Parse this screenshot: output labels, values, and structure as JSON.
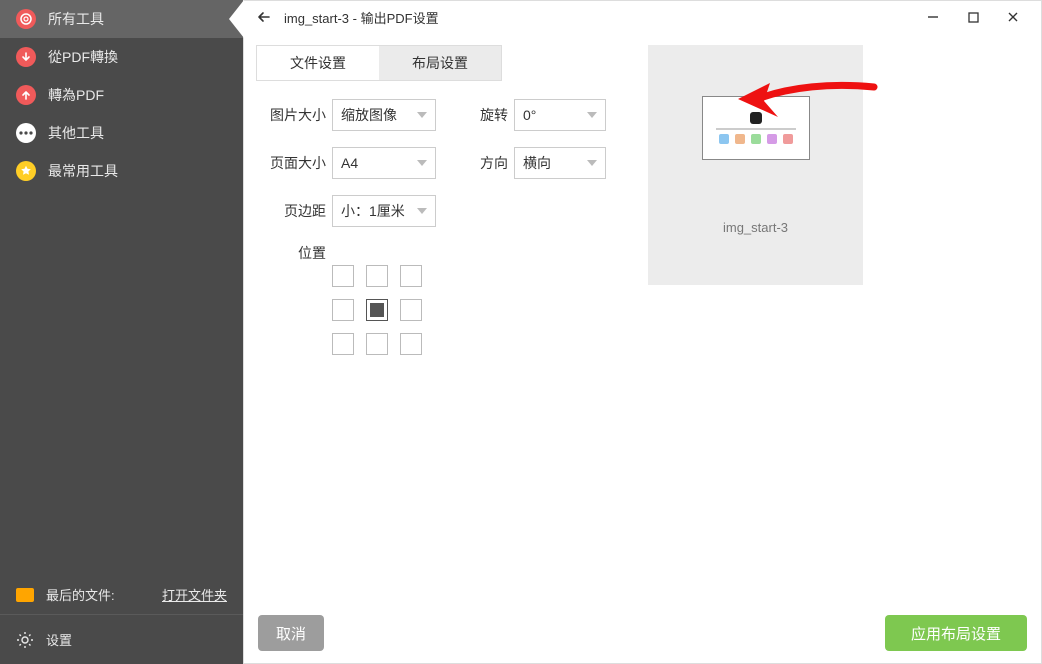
{
  "sidebar": {
    "items": [
      {
        "label": "所有工具",
        "icon": "spiral",
        "active": true
      },
      {
        "label": "從PDF轉換",
        "icon": "down"
      },
      {
        "label": "轉為PDF",
        "icon": "up"
      },
      {
        "label": "其他工具",
        "icon": "dots"
      },
      {
        "label": "最常用工具",
        "icon": "star"
      }
    ],
    "lastfile_label": "最后的文件:",
    "openfolder_label": "打开文件夹",
    "settings_label": "设置"
  },
  "titlebar": {
    "title": "img_start-3 - 输出PDF设置"
  },
  "tabs": {
    "file": "文件设置",
    "layout": "布局设置"
  },
  "form": {
    "image_size_label": "图片大小",
    "image_size_value": "缩放图像",
    "rotate_label": "旋转",
    "rotate_value": "0°",
    "page_size_label": "页面大小",
    "page_size_value": "A4",
    "orientation_label": "方向",
    "orientation_value": "横向",
    "margin_label": "页边距",
    "margin_value": "小：1厘米",
    "position_label": "位置",
    "position_selected_index": 4
  },
  "preview": {
    "caption": "img_start-3"
  },
  "footer": {
    "cancel": "取消",
    "apply": "应用布局设置"
  }
}
